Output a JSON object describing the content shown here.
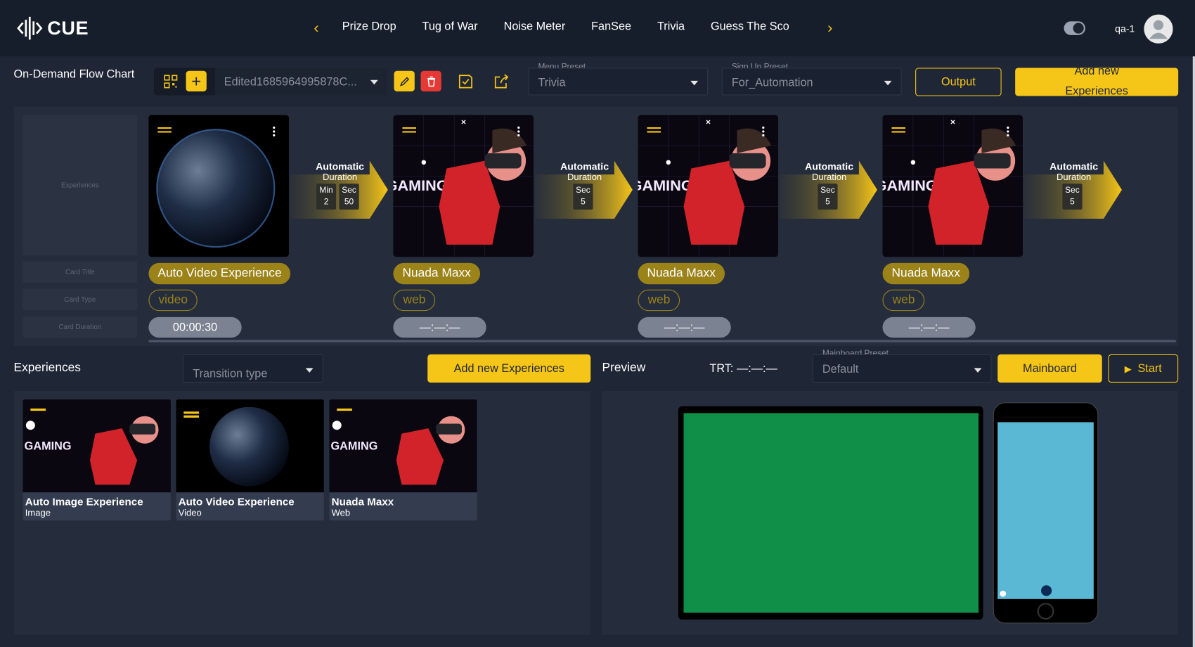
{
  "app": {
    "logo_text": "CUE"
  },
  "nav": {
    "items": [
      "Prize Drop",
      "Tug of War",
      "Noise Meter",
      "FanSee",
      "Trivia",
      "Guess The Sco"
    ]
  },
  "user": {
    "name": "qa-1"
  },
  "flow": {
    "title": "On-Demand Flow Chart",
    "selected_flow": "Edited1685964995878C...",
    "menu_preset": {
      "label": "Menu Preset",
      "value": "Trivia"
    },
    "signup_preset": {
      "label": "Sign Up Preset",
      "value": "For_Automation"
    },
    "output_label": "Output",
    "add_new_label": "Add new Experiences"
  },
  "sidebar_labels": {
    "experiences": "Experiences",
    "card_title": "Card Title",
    "card_type": "Card Type",
    "card_duration": "Card Duration"
  },
  "cards": [
    {
      "title": "Auto Video Experience",
      "type": "video",
      "duration": "00:00:30",
      "image": "earth"
    },
    {
      "title": "Nuada Maxx",
      "type": "web",
      "duration": "—:—:—",
      "image": "gaming"
    },
    {
      "title": "Nuada Maxx",
      "type": "web",
      "duration": "—:—:—",
      "image": "gaming"
    },
    {
      "title": "Nuada Maxx",
      "type": "web",
      "duration": "—:—:—",
      "image": "gaming"
    }
  ],
  "transitions": [
    {
      "title": "Automatic",
      "sub": "Duration",
      "fields": [
        {
          "label": "Min",
          "value": "2"
        },
        {
          "label": "Sec",
          "value": "50"
        }
      ]
    },
    {
      "title": "Automatic",
      "sub": "Duration",
      "fields": [
        {
          "label": "Sec",
          "value": "5"
        }
      ]
    },
    {
      "title": "Automatic",
      "sub": "Duration",
      "fields": [
        {
          "label": "Sec",
          "value": "5"
        }
      ]
    },
    {
      "title": "Automatic",
      "sub": "Duration",
      "fields": [
        {
          "label": "Sec",
          "value": "5"
        }
      ]
    }
  ],
  "experiences": {
    "title": "Experiences",
    "transition_placeholder": "Transition type",
    "add_label": "Add new Experiences",
    "items": [
      {
        "name": "Auto Image Experience",
        "type": "Image",
        "image": "gaming"
      },
      {
        "name": "Auto Video Experience",
        "type": "Video",
        "image": "earth"
      },
      {
        "name": "Nuada Maxx",
        "type": "Web",
        "image": "gaming"
      }
    ]
  },
  "preview": {
    "title": "Preview",
    "trt": "TRT: —:—:—",
    "mainboard_preset": {
      "label": "Mainboard Preset",
      "value": "Default"
    },
    "mainboard_label": "Mainboard",
    "start_label": "Start",
    "tablet_color": "#0f8f47",
    "phone_color": "#5bb8d4"
  },
  "gaming_text": "GAMING",
  "colors": {
    "accent": "#f5c518",
    "bg": "#1f2635",
    "panel": "#252d3d"
  }
}
